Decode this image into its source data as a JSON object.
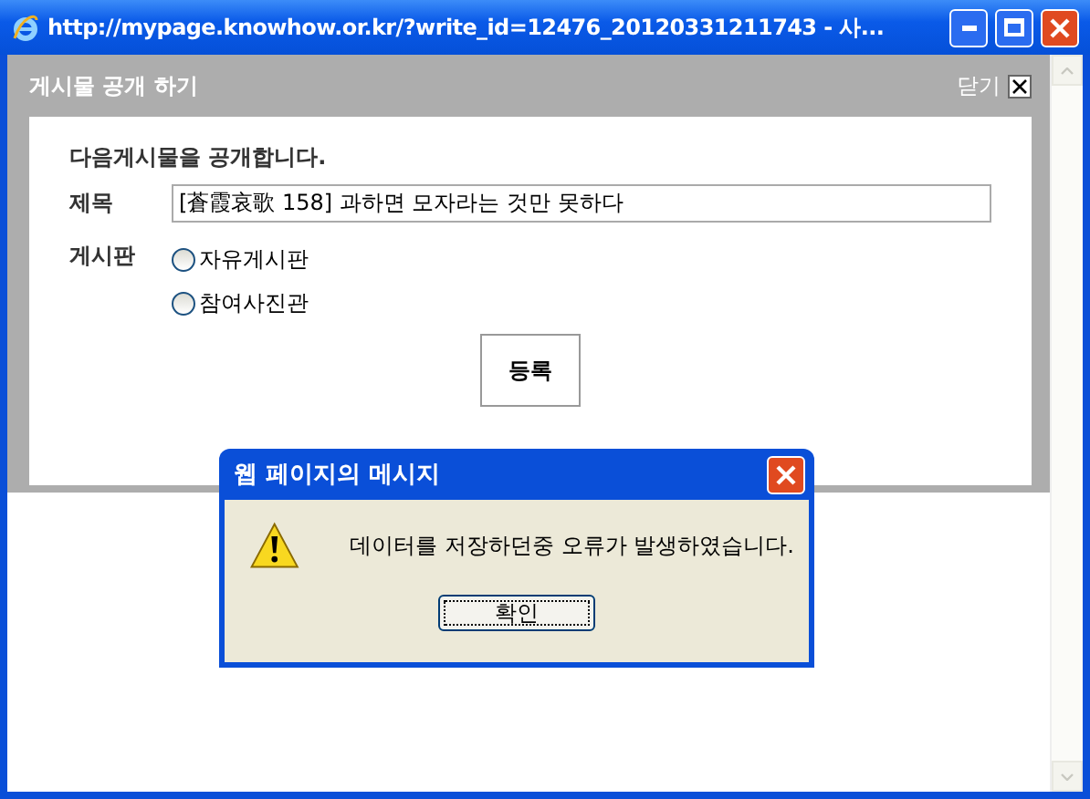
{
  "window": {
    "title": "http://mypage.knowhow.or.kr/?write_id=12476_20120331211743 - 사..."
  },
  "panel": {
    "title": "게시물 공개 하기",
    "close_label": "닫기"
  },
  "form": {
    "intro": "다음게시물을 공개합니다.",
    "subject_label": "제목",
    "subject_value": "[蒼霞哀歌 158] 과하면 모자라는 것만 못하다",
    "board_label": "게시판",
    "boards": [
      {
        "label": "자유게시판",
        "selected": false
      },
      {
        "label": "참여사진관",
        "selected": false
      }
    ],
    "submit": "등록"
  },
  "alert": {
    "title": "웹 페이지의 메시지",
    "message": "데이터를 저장하던중 오류가 발생하였습니다.",
    "ok": "확인"
  }
}
